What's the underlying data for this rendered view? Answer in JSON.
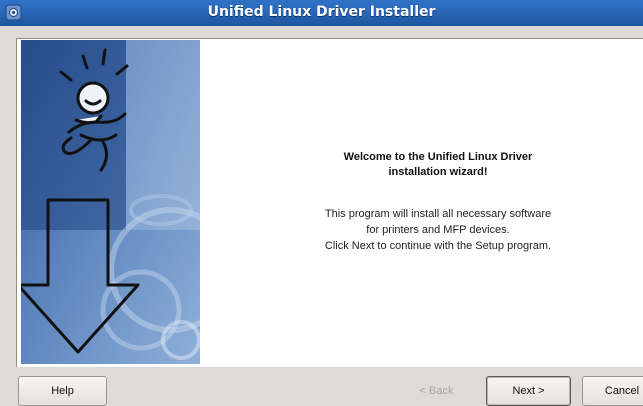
{
  "window": {
    "title": "Unified Linux Driver Installer",
    "icon": "app-gear-icon"
  },
  "banner": {
    "illustration": "running-figure-with-down-arrow",
    "accent_color": "#5a7fb8"
  },
  "content": {
    "welcome_line1": "Welcome to the Unified Linux Driver",
    "welcome_line2": "installation wizard!",
    "desc_line1": "This program will install all necessary software",
    "desc_line2": "for printers and MFP devices.",
    "desc_line3": "Click Next to continue with the Setup program."
  },
  "buttons": {
    "help": "Help",
    "back": "< Back",
    "next": "Next >",
    "cancel": "Cancel"
  }
}
